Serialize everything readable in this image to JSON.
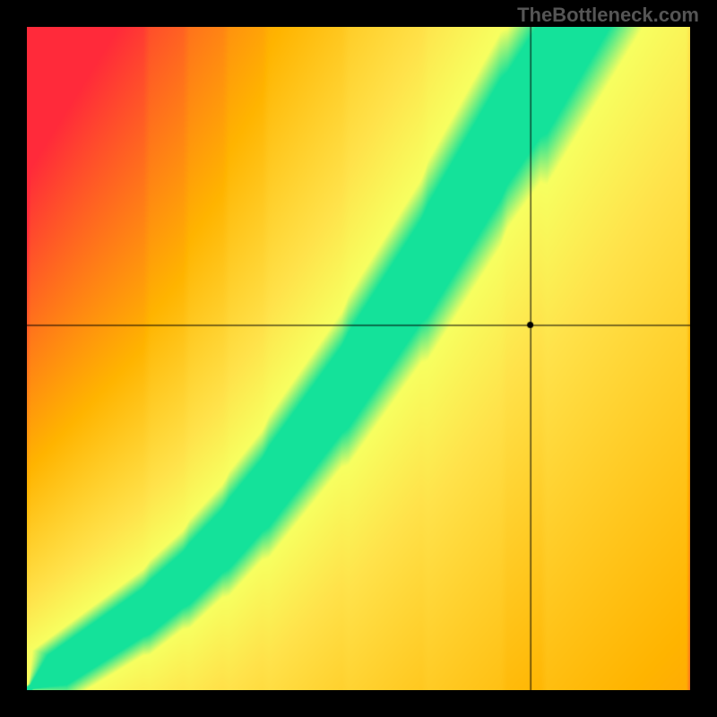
{
  "watermark": "TheBottleneck.com",
  "chart_data": {
    "type": "heatmap",
    "title": "",
    "xlabel": "",
    "ylabel": "",
    "xlim": [
      0,
      100
    ],
    "ylim": [
      0,
      100
    ],
    "crosshair": {
      "x": 76,
      "y": 55
    },
    "marker": {
      "x": 76,
      "y": 55,
      "color": "#000000",
      "radius": 3.5
    },
    "ridge": {
      "description": "Green optimal band; points are (x_percent, y_percent) along the ridge center, origin bottom-left",
      "points": [
        [
          0,
          0
        ],
        [
          6,
          4
        ],
        [
          12,
          8
        ],
        [
          18,
          12
        ],
        [
          24,
          17
        ],
        [
          30,
          23
        ],
        [
          36,
          30
        ],
        [
          42,
          38
        ],
        [
          48,
          46
        ],
        [
          54,
          55
        ],
        [
          60,
          64
        ],
        [
          66,
          74
        ],
        [
          72,
          84
        ],
        [
          78,
          93
        ],
        [
          82,
          100
        ]
      ],
      "half_width_percent_start": 2.5,
      "half_width_percent_end": 5.5
    },
    "colors": {
      "far": "#ff2a3a",
      "mid": "#ffb400",
      "near": "#ffe24a",
      "close": "#f7ff60",
      "best": "#14e29a"
    }
  }
}
